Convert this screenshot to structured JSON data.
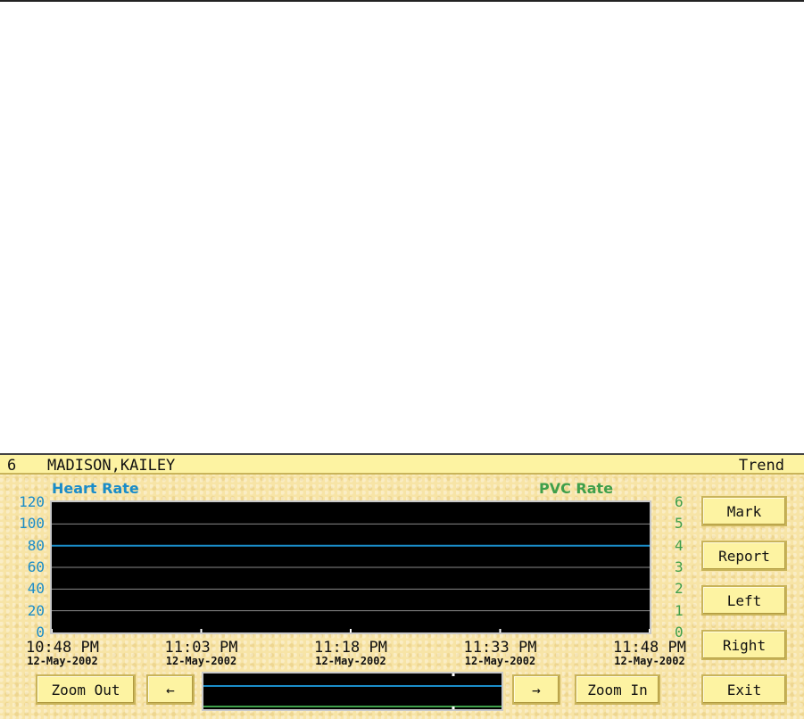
{
  "header": {
    "bed": "6",
    "patient": "MADISON,KAILEY",
    "mode": "Trend"
  },
  "params": {
    "left_label": "Heart Rate",
    "right_label": "PVC Rate"
  },
  "colors": {
    "heart_rate": "#1a8cc8",
    "pvc_rate": "#3f9f4a",
    "plot_bg": "#000000",
    "panel_bg": "#f7e4a6",
    "button_bg": "#fdf3a2"
  },
  "chart_data": {
    "type": "line",
    "y_left": {
      "ticks": [
        "120",
        "100",
        "80",
        "60",
        "40",
        "20",
        "0"
      ],
      "range": [
        0,
        120
      ]
    },
    "y_right": {
      "ticks": [
        "6",
        "5",
        "4",
        "3",
        "2",
        "1",
        "0"
      ],
      "range": [
        0,
        6
      ]
    },
    "x_ticks": [
      {
        "time": "10:48 PM",
        "date": "12-May-2002"
      },
      {
        "time": "11:03 PM",
        "date": "12-May-2002"
      },
      {
        "time": "11:18 PM",
        "date": "12-May-2002"
      },
      {
        "time": "11:33 PM",
        "date": "12-May-2002"
      },
      {
        "time": "11:48 PM",
        "date": "12-May-2002"
      }
    ],
    "series": [
      {
        "name": "Heart Rate",
        "axis": "left",
        "values": [
          80,
          80,
          80,
          80,
          80
        ]
      }
    ],
    "grid": true
  },
  "buttons": {
    "mark": "Mark",
    "report": "Report",
    "left": "Left",
    "right": "Right",
    "exit": "Exit",
    "zoom_out": "Zoom Out",
    "zoom_in": "Zoom In",
    "scroll_left": "←",
    "scroll_right": "→"
  }
}
